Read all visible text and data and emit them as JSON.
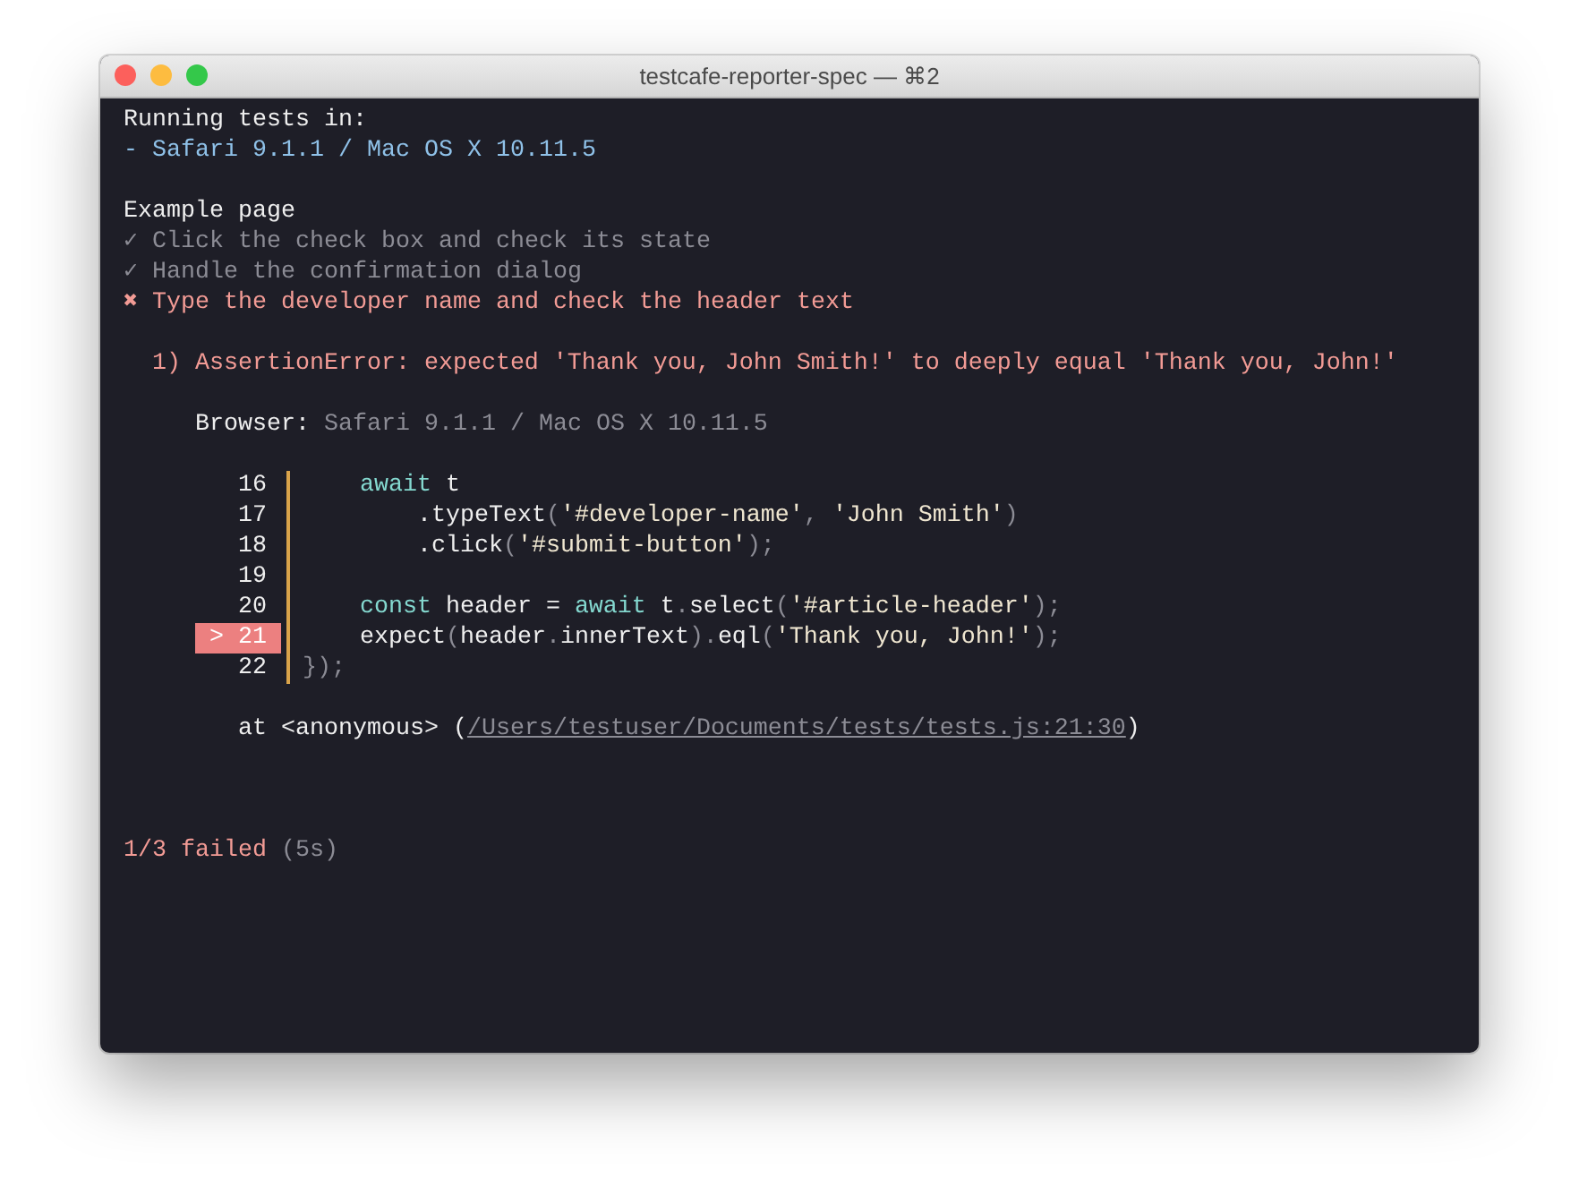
{
  "window": {
    "title": "testcafe-reporter-spec — ⌘2"
  },
  "header": {
    "label": "Running tests in:",
    "browsers": [
      "- Safari 9.1.1 / Mac OS X 10.11.5"
    ]
  },
  "fixture": {
    "name": "Example page",
    "tests": [
      {
        "icon": "✓",
        "name": "Click the check box and check its state",
        "passed": true
      },
      {
        "icon": "✓",
        "name": "Handle the confirmation dialog",
        "passed": true
      },
      {
        "icon": "✖",
        "name": "Type the developer name and check the header text",
        "passed": false
      }
    ]
  },
  "error": {
    "message": "1) AssertionError: expected 'Thank you, John Smith!' to deeply equal 'Thank you, John!'",
    "browser_label": "Browser:",
    "browser_value": "Safari 9.1.1 / Mac OS X 10.11.5",
    "code_lines": [
      {
        "number": "16",
        "current": false,
        "tokens": [
          {
            "kind": "keyword",
            "text": "    await"
          },
          {
            "kind": "plain",
            "text": " t"
          }
        ]
      },
      {
        "number": "17",
        "current": false,
        "tokens": [
          {
            "kind": "plain",
            "text": "        .typeText"
          },
          {
            "kind": "punct",
            "text": "("
          },
          {
            "kind": "string",
            "text": "'#developer-name'"
          },
          {
            "kind": "punct",
            "text": ", "
          },
          {
            "kind": "string",
            "text": "'John Smith'"
          },
          {
            "kind": "punct",
            "text": ")"
          }
        ]
      },
      {
        "number": "18",
        "current": false,
        "tokens": [
          {
            "kind": "plain",
            "text": "        .click"
          },
          {
            "kind": "punct",
            "text": "("
          },
          {
            "kind": "string",
            "text": "'#submit-button'"
          },
          {
            "kind": "punct",
            "text": ");"
          }
        ]
      },
      {
        "number": "19",
        "current": false
      },
      {
        "number": "20",
        "current": false,
        "tokens": [
          {
            "kind": "keyword",
            "text": "    const"
          },
          {
            "kind": "plain",
            "text": " header = "
          },
          {
            "kind": "keyword",
            "text": "await"
          },
          {
            "kind": "plain",
            "text": " t"
          },
          {
            "kind": "punct",
            "text": "."
          },
          {
            "kind": "plain",
            "text": "select"
          },
          {
            "kind": "punct",
            "text": "("
          },
          {
            "kind": "string",
            "text": "'#article-header'"
          },
          {
            "kind": "punct",
            "text": ");"
          }
        ]
      },
      {
        "number": "21",
        "marker": ">",
        "current": true,
        "tokens": [
          {
            "kind": "plain",
            "text": "    expect"
          },
          {
            "kind": "punct",
            "text": "("
          },
          {
            "kind": "plain",
            "text": "header"
          },
          {
            "kind": "punct",
            "text": "."
          },
          {
            "kind": "plain",
            "text": "innerText"
          },
          {
            "kind": "punct",
            "text": ")."
          },
          {
            "kind": "plain",
            "text": "eql"
          },
          {
            "kind": "punct",
            "text": "("
          },
          {
            "kind": "string",
            "text": "'Thank you, John!'"
          },
          {
            "kind": "punct",
            "text": ");"
          }
        ]
      },
      {
        "number": "22",
        "current": false,
        "tokens": [
          {
            "kind": "punct",
            "text": "});"
          }
        ]
      }
    ],
    "stack_prefix": "at <anonymous> (",
    "stack_link": "/Users/testuser/Documents/tests/tests.js:21:30",
    "stack_suffix": ")"
  },
  "summary": {
    "result": "1/3 failed",
    "duration": "(5s)"
  }
}
